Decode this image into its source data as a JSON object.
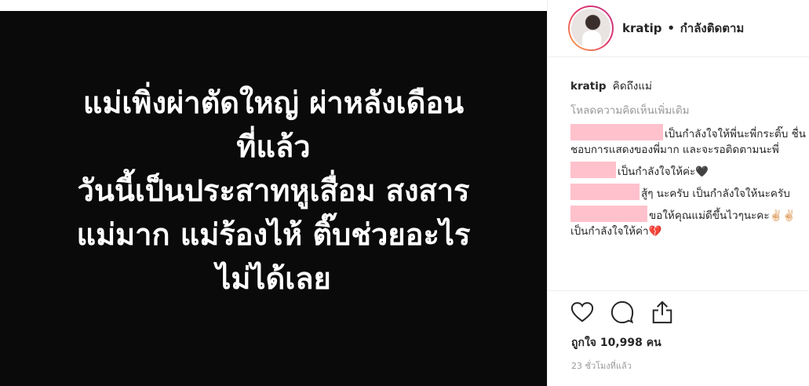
{
  "post": {
    "lines": [
      "แม่เพิ่งผ่าตัดใหญ่ ผ่าหลังเดือน",
      "ที่แล้ว",
      "วันนี้เป็นประสาทหูเสื่อม สงสาร",
      "แม่มาก แม่ร้องไห้ ติ๊บช่วยอะไร",
      "ไม่ได้เลย"
    ]
  },
  "header": {
    "username": "kratip",
    "dot": "•",
    "follow_label": "กำลังติดตาม"
  },
  "caption": {
    "username": "kratip",
    "text": "คิดถึงแม่"
  },
  "load_more": "โหลดความคิดเห็นเพิ่มเติม",
  "comments": [
    {
      "text": "เป็นกำลังใจให้พี่นะพี่กระติ๊บ ชื่นชอบการแสดงของพี่มาก และจะรอติดตามนะพี่"
    },
    {
      "text": "เป็นกำลังใจให้ค่ะ🖤"
    },
    {
      "text": "สู้ๆ นะครับ เป็นกำลังใจให้นะครับ"
    },
    {
      "text": "ขอให้คุณแม่ดีขึ้นไวๆนะคะ✌🏻✌🏻เป็นกำลังใจให้ค่า💔"
    }
  ],
  "likes": "ถูกใจ 10,998 คน",
  "time": "23 ชั่วโมงที่แล้ว",
  "icons": {
    "like": "heart-icon",
    "comment": "comment-icon",
    "share": "share-icon"
  }
}
